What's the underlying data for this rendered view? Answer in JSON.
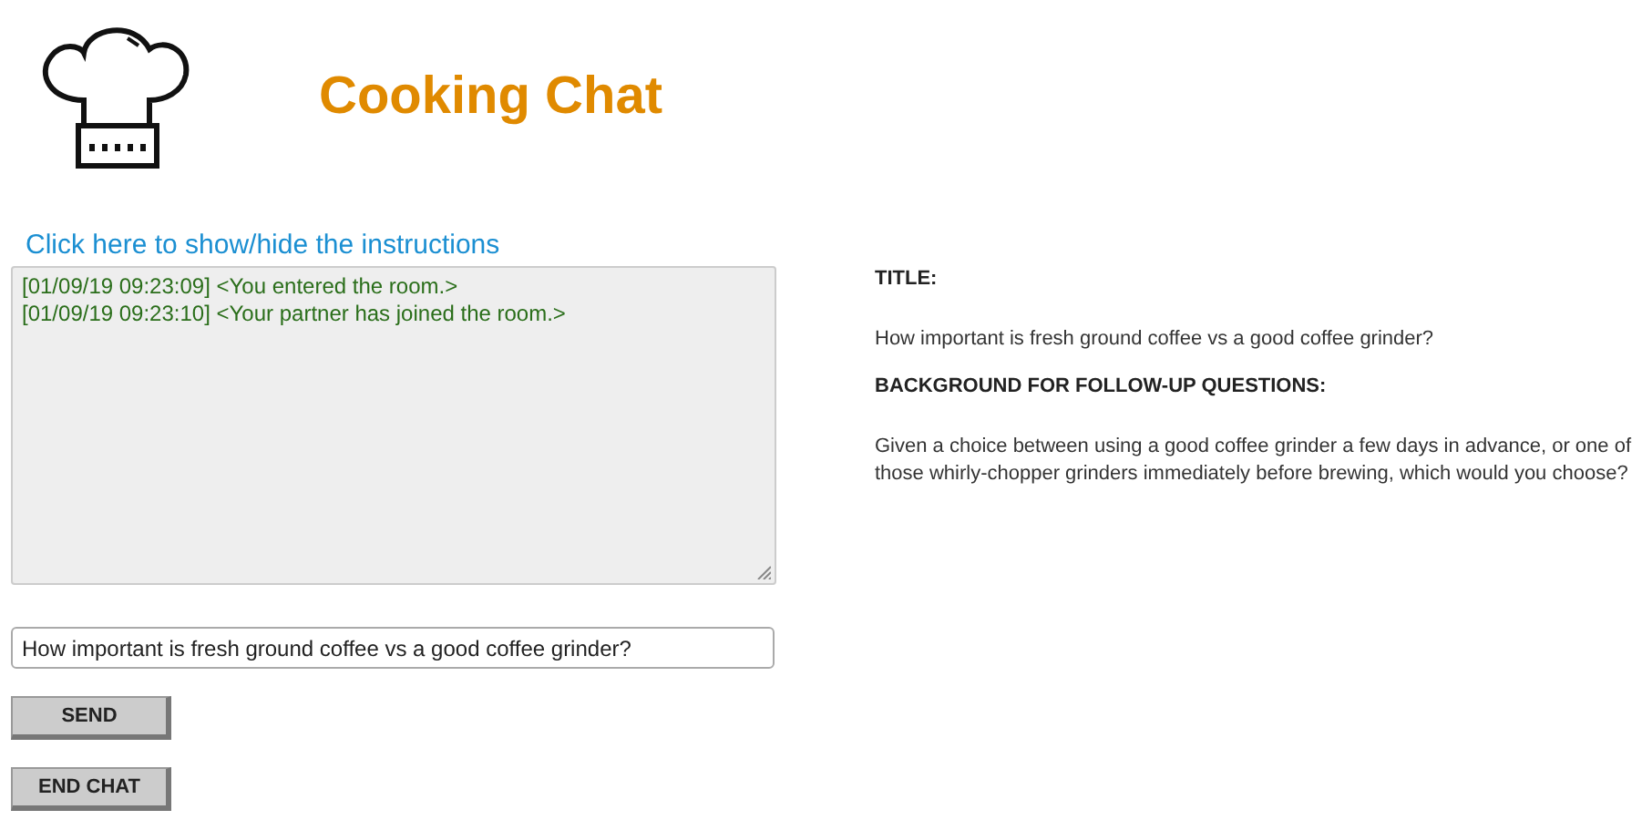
{
  "header": {
    "title": "Cooking Chat"
  },
  "instructions_link": "Click here to show/hide the instructions",
  "chat_log": [
    {
      "time": "[01/09/19 09:23:09]",
      "text": "<You entered the room.>"
    },
    {
      "time": "[01/09/19 09:23:10]",
      "text": "<Your partner has joined the room.>"
    }
  ],
  "message_input": {
    "value": "How important is fresh ground coffee vs a good coffee grinder?"
  },
  "buttons": [
    "SEND",
    "END CHAT"
  ],
  "info": [
    {
      "kind": "heading",
      "text": "TITLE:"
    },
    {
      "kind": "paragraph",
      "text": "How important is fresh ground coffee vs a good coffee grinder?"
    },
    {
      "kind": "heading",
      "text": "BACKGROUND FOR FOLLOW-UP QUESTIONS:"
    },
    {
      "kind": "paragraph",
      "text": "Given a choice between using a good coffee grinder a few days in advance, or one of those whirly-chopper grinders immediately before brewing, which would you choose?"
    }
  ]
}
